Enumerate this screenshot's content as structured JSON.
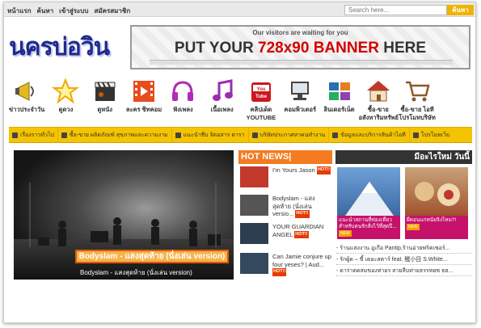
{
  "topbar": {
    "nav": [
      "หน้าแรก",
      "ค้นหา",
      "เข้าสู่ระบบ",
      "สมัครสมาชิก"
    ],
    "search_placeholder": "Search here...",
    "search_button": "ค้นหา"
  },
  "header": {
    "logo_text": "นครบ่อวิน",
    "banner_sub": "Our visitors are waiting for you",
    "banner_main_a": "PUT YOUR ",
    "banner_main_b": "728x90 BANNER",
    "banner_main_c": " HERE"
  },
  "icons": [
    {
      "label": "ข่าวประจำวัน",
      "icon": "megaphone-icon",
      "color": "#d4a017"
    },
    {
      "label": "ดูดวง",
      "icon": "star-icon",
      "color": "#f2b400"
    },
    {
      "label": "ดูหนัง",
      "icon": "clapperboard-icon",
      "color": "#333333"
    },
    {
      "label": "ละคร ซิทคอม",
      "icon": "film-icon",
      "color": "#e74c1c"
    },
    {
      "label": "ฟังเพลง",
      "icon": "headphones-icon",
      "color": "#b12bb4"
    },
    {
      "label": "เนื้อเพลง",
      "icon": "music-note-icon",
      "color": "#9b2bb4"
    },
    {
      "label": "คลิปเด็ด YOUTUBE",
      "icon": "youtube-icon",
      "color": "#cc181e"
    },
    {
      "label": "คอมพิวเตอร์",
      "icon": "computer-icon",
      "color": "#444444"
    },
    {
      "label": "ลินเดอร์เน็ต",
      "icon": "network-icon",
      "color": "#2a6fb4"
    },
    {
      "label": "ซื้อ-ขาย อสังหาริมทรัพย์",
      "icon": "house-icon",
      "color": "#c0392b"
    },
    {
      "label": "ซื้อ-ขาย ไอที โปรโมทบริษัท",
      "icon": "cart-icon",
      "color": "#8a5a2b"
    }
  ],
  "categories": [
    "เรื่องราวทั่วไป",
    "ซื้อ-ขาย ผลิตภัณฑ์ สุขภาพและความงาม",
    "แนะนำชีบ จิตอสาร ดารา",
    "บริษัทประกาศหาคนทำงาน",
    "ข้อมูลและบริการสินค้าไอที",
    "โปรโมทเว็บ"
  ],
  "video": {
    "caption": "Bodyslam - แสงสุดท้าย (นั่งเล่น version)",
    "subtitle": "Bodyslam - แสงสุดท้าย (นั่งเล่น version)"
  },
  "hot_news": {
    "title": "HOT NEWS|",
    "hot_tag": "HOT!!",
    "items": [
      {
        "text": "I'm Yours Jason",
        "thumb": "#c0392b"
      },
      {
        "text": "Bodyslam - แสงสุดท้าย (นั่งเล่น versio...",
        "thumb": "#555555"
      },
      {
        "text": "YOUR GUARDIAN ANGEL",
        "thumb": "#2c3e50"
      },
      {
        "text": "Can Jamie conjure up four yeses? | Aud...",
        "thumb": "#34495e"
      }
    ]
  },
  "whats_new": {
    "title": "มีอะไรใหม่ วันนี้",
    "tag": "NEW",
    "cards": [
      {
        "caption": "แนะนำสถานที่ท่องเที่ยวสำหรับคนรักสิ่งไว้ที่สุดปี...",
        "img": "#3b6aa0"
      },
      {
        "caption": "ผีดอนแกหนัยจิงไหม?!",
        "img": "#a0522d"
      }
    ],
    "list": [
      "- ร้านแสงงาน อูเกือ Pantip,ร้านอ่ายพริคเซอร์...",
      "- รักผู้ด – ขี้ เดอะสตาร์ feat. 醒小目 S.White...",
      "- ดาร่าตดสมของท่ายร สายลีบท่ายธรรหยซ ธธ..."
    ]
  }
}
